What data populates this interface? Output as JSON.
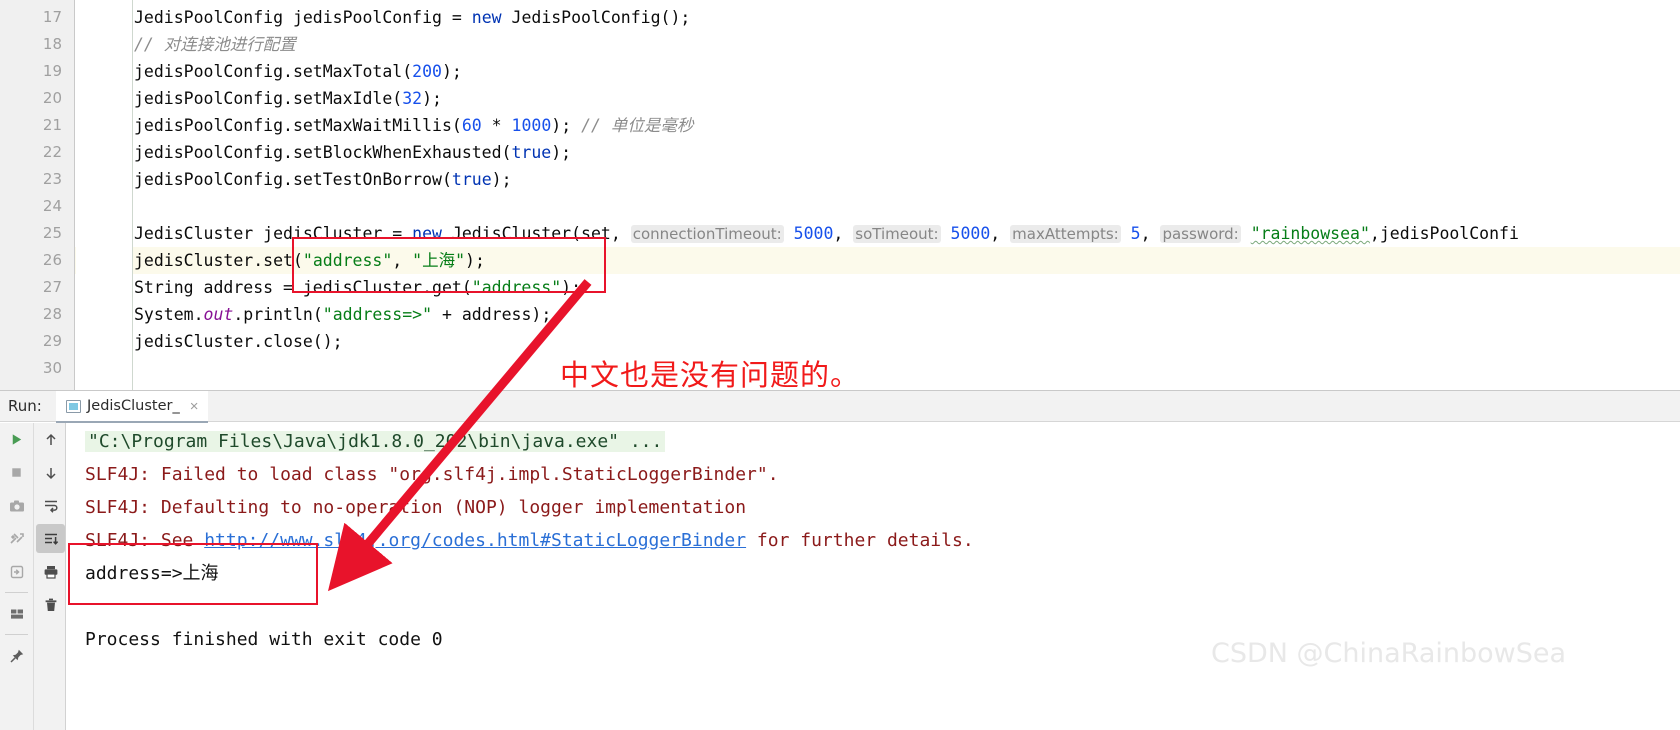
{
  "editor": {
    "first_line_number": 17,
    "highlighted_line": 26,
    "lines": [
      {
        "n": 17,
        "indent": 0,
        "segments": [
          {
            "t": "JedisPoolConfig jedisPoolConfig = ",
            "c": "plain"
          },
          {
            "t": "new",
            "c": "kw"
          },
          {
            "t": " JedisPoolConfig();",
            "c": "plain"
          }
        ]
      },
      {
        "n": 18,
        "indent": 0,
        "segments": [
          {
            "t": "// 对连接池进行配置",
            "c": "cmt"
          }
        ]
      },
      {
        "n": 19,
        "indent": 0,
        "segments": [
          {
            "t": "jedisPoolConfig.setMaxTotal(",
            "c": "plain"
          },
          {
            "t": "200",
            "c": "num"
          },
          {
            "t": ");",
            "c": "plain"
          }
        ]
      },
      {
        "n": 20,
        "indent": 0,
        "segments": [
          {
            "t": "jedisPoolConfig.setMaxIdle(",
            "c": "plain"
          },
          {
            "t": "32",
            "c": "num"
          },
          {
            "t": ");",
            "c": "plain"
          }
        ]
      },
      {
        "n": 21,
        "indent": 0,
        "segments": [
          {
            "t": "jedisPoolConfig.setMaxWaitMillis(",
            "c": "plain"
          },
          {
            "t": "60",
            "c": "num"
          },
          {
            "t": " * ",
            "c": "plain"
          },
          {
            "t": "1000",
            "c": "num"
          },
          {
            "t": "); ",
            "c": "plain"
          },
          {
            "t": "// 单位是毫秒",
            "c": "cmt"
          }
        ]
      },
      {
        "n": 22,
        "indent": 0,
        "segments": [
          {
            "t": "jedisPoolConfig.setBlockWhenExhausted(",
            "c": "plain"
          },
          {
            "t": "true",
            "c": "kw"
          },
          {
            "t": ");",
            "c": "plain"
          }
        ]
      },
      {
        "n": 23,
        "indent": 0,
        "segments": [
          {
            "t": "jedisPoolConfig.setTestOnBorrow(",
            "c": "plain"
          },
          {
            "t": "true",
            "c": "kw"
          },
          {
            "t": ");",
            "c": "plain"
          }
        ]
      },
      {
        "n": 24,
        "indent": 0,
        "segments": []
      },
      {
        "n": 25,
        "indent": 0,
        "segments": [
          {
            "t": "JedisCluster jedisCluster = ",
            "c": "plain"
          },
          {
            "t": "new",
            "c": "kw"
          },
          {
            "t": " JedisCluster(set, ",
            "c": "plain"
          },
          {
            "t": "connectionTimeout:",
            "c": "hint"
          },
          {
            "t": " ",
            "c": "plain"
          },
          {
            "t": "5000",
            "c": "num"
          },
          {
            "t": ", ",
            "c": "plain"
          },
          {
            "t": "soTimeout:",
            "c": "hint"
          },
          {
            "t": " ",
            "c": "plain"
          },
          {
            "t": "5000",
            "c": "num"
          },
          {
            "t": ", ",
            "c": "plain"
          },
          {
            "t": "maxAttempts:",
            "c": "hint"
          },
          {
            "t": " ",
            "c": "plain"
          },
          {
            "t": "5",
            "c": "num"
          },
          {
            "t": ", ",
            "c": "plain"
          },
          {
            "t": "password:",
            "c": "hint"
          },
          {
            "t": " ",
            "c": "plain"
          },
          {
            "t": "\"rainbowsea\"",
            "c": "str-sq"
          },
          {
            "t": ",jedisPoolConfi",
            "c": "plain"
          }
        ]
      },
      {
        "n": 26,
        "indent": 0,
        "segments": [
          {
            "t": "jedisCluster.set(",
            "c": "plain"
          },
          {
            "t": "\"address\"",
            "c": "str"
          },
          {
            "t": ", ",
            "c": "plain"
          },
          {
            "t": "\"上海\"",
            "c": "str"
          },
          {
            "t": ");",
            "c": "plain"
          }
        ]
      },
      {
        "n": 27,
        "indent": 0,
        "segments": [
          {
            "t": "String address = jedisCluster.get(",
            "c": "plain"
          },
          {
            "t": "\"address\"",
            "c": "str"
          },
          {
            "t": ");",
            "c": "plain"
          }
        ]
      },
      {
        "n": 28,
        "indent": 0,
        "segments": [
          {
            "t": "System.",
            "c": "plain"
          },
          {
            "t": "out",
            "c": "fld"
          },
          {
            "t": ".println(",
            "c": "plain"
          },
          {
            "t": "\"address=>\"",
            "c": "str"
          },
          {
            "t": " + address);",
            "c": "plain"
          }
        ]
      },
      {
        "n": 29,
        "indent": 0,
        "segments": [
          {
            "t": "jedisCluster.close();",
            "c": "plain"
          }
        ]
      },
      {
        "n": 30,
        "indent": 0,
        "segments": []
      }
    ]
  },
  "run_panel": {
    "label": "Run:",
    "tab": {
      "title": "JedisCluster_",
      "close": "×"
    },
    "toolbar_left": [
      {
        "name": "rerun-icon",
        "glyph": "run"
      },
      {
        "name": "stop-icon",
        "glyph": "stop"
      },
      {
        "name": "screenshot-icon",
        "glyph": "camera"
      },
      {
        "name": "dump-threads-icon",
        "glyph": "threads"
      },
      {
        "name": "restore-layout-icon",
        "glyph": "login"
      },
      {
        "name": "layout-settings-icon",
        "glyph": "layout"
      },
      {
        "name": "pin-tab-icon",
        "glyph": "pin"
      }
    ],
    "toolbar_right": [
      {
        "name": "up-the-stack-trace-icon",
        "glyph": "up"
      },
      {
        "name": "down-the-stack-trace-icon",
        "glyph": "down"
      },
      {
        "name": "soft-wrap-icon",
        "glyph": "wrap"
      },
      {
        "name": "scroll-to-end-icon",
        "glyph": "scrollend",
        "selected": true
      },
      {
        "name": "print-icon",
        "glyph": "print"
      },
      {
        "name": "clear-all-icon",
        "glyph": "trash"
      }
    ],
    "console_lines": [
      {
        "kind": "cmd",
        "text": "\"C:\\Program Files\\Java\\jdk1.8.0_202\\bin\\java.exe\" ..."
      },
      {
        "kind": "err",
        "text": "SLF4J: Failed to load class \"org.slf4j.impl.StaticLoggerBinder\"."
      },
      {
        "kind": "err",
        "text": "SLF4J: Defaulting to no-operation (NOP) logger implementation"
      },
      {
        "kind": "err-link",
        "pre": "SLF4J: See ",
        "link": "http://www.slf4j.org/codes.html#StaticLoggerBinder",
        "post": " for further details."
      },
      {
        "kind": "out",
        "text": "address=>上海"
      },
      {
        "kind": "blank",
        "text": ""
      },
      {
        "kind": "out",
        "text": "Process finished with exit code 0"
      }
    ]
  },
  "annotations": {
    "note_text": "中文也是没有问题的。",
    "note_color": "#f11a1a",
    "box_color": "#e8132b",
    "arrow_color": "#e8132b"
  },
  "watermark": {
    "text": "CSDN @ChinaRainbowSea",
    "color": "#e8e8e8"
  }
}
